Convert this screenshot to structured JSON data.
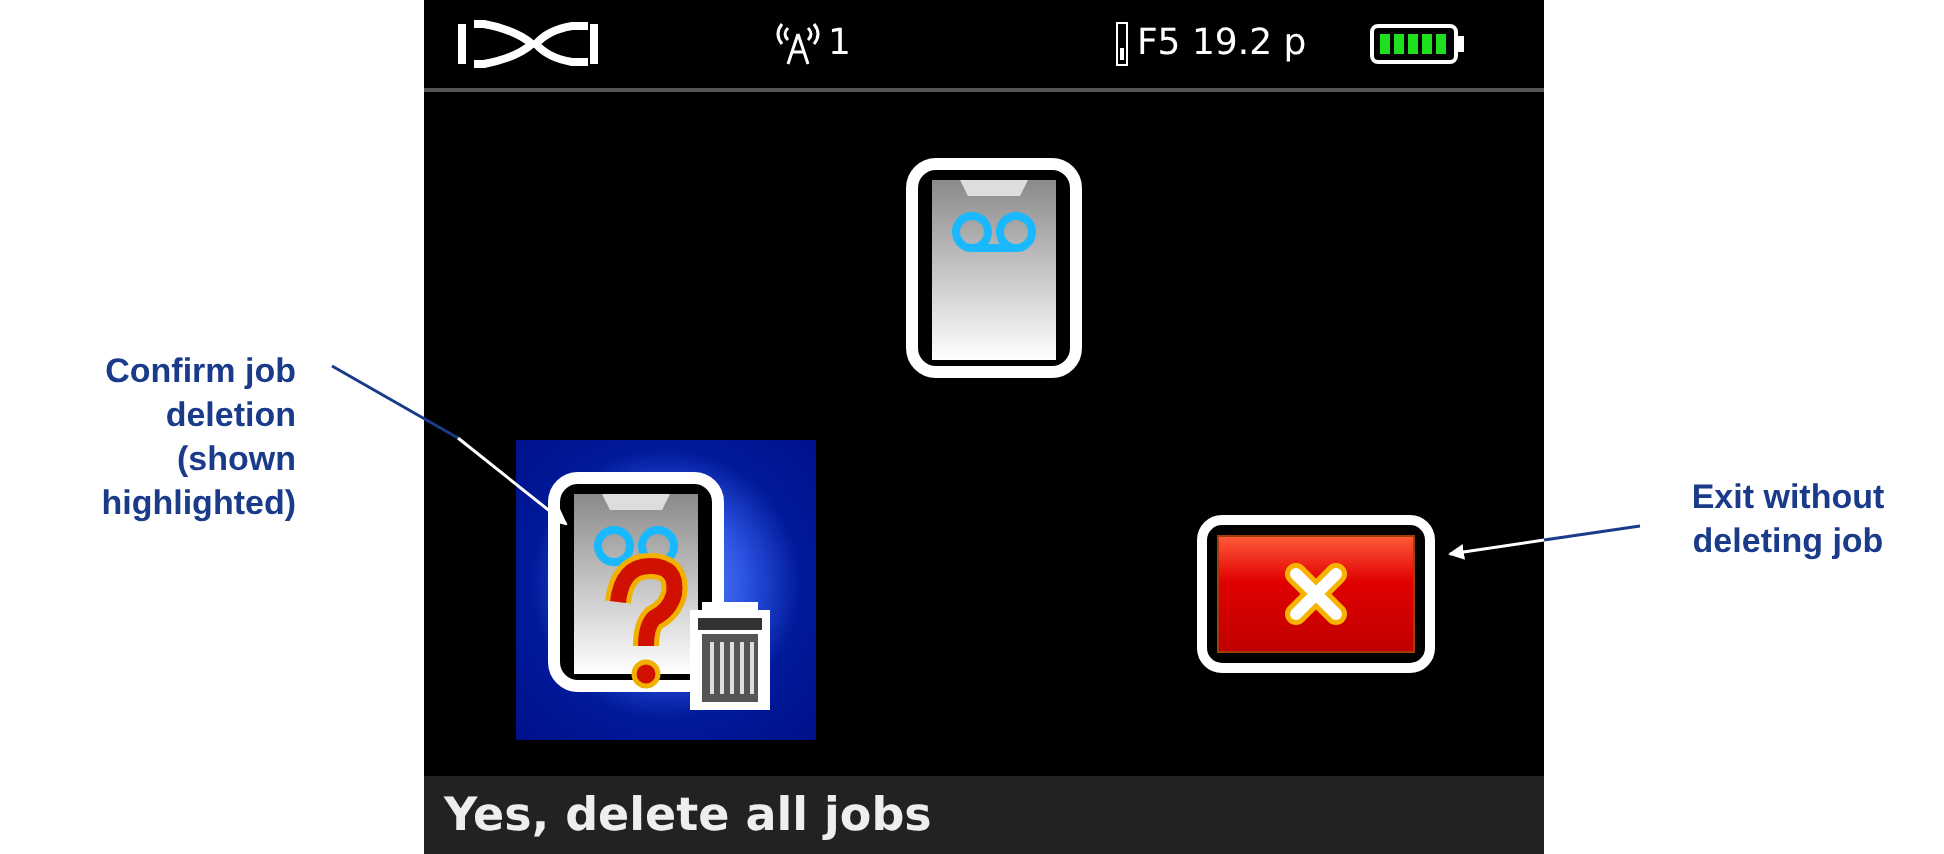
{
  "status_bar": {
    "channel": "1",
    "frequency": "F5 19.2 p"
  },
  "menu": {
    "items": [
      {
        "kind": "job",
        "selected": false
      },
      {
        "kind": "delete",
        "selected": true
      },
      {
        "kind": "exit",
        "selected": false
      }
    ]
  },
  "footer": {
    "label": "Yes, delete all jobs"
  },
  "left_callout": {
    "lines": [
      "Confirm job",
      "deletion",
      "(shown",
      "highlighted)"
    ]
  },
  "right_callout": {
    "lines": [
      "Exit without",
      "deleting job"
    ]
  }
}
